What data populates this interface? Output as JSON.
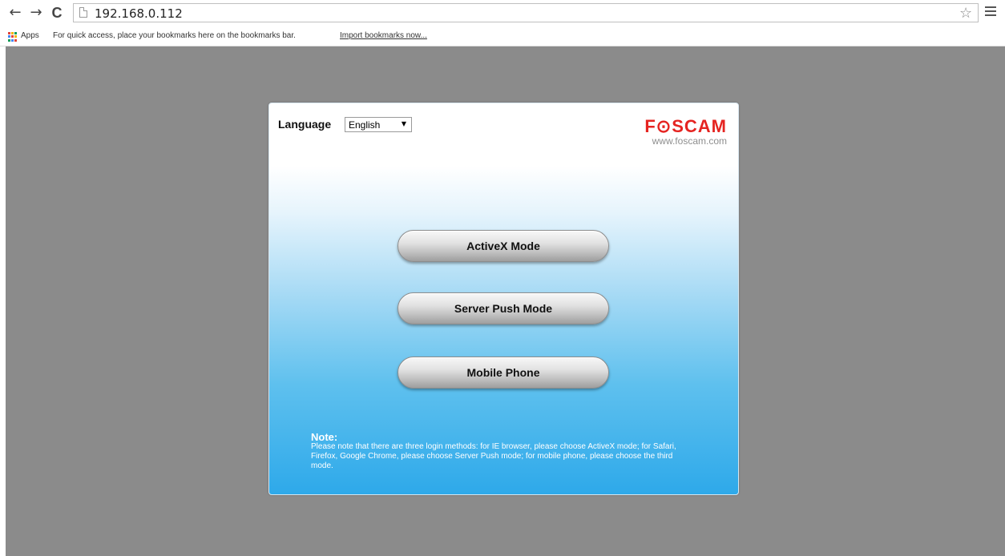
{
  "browser": {
    "back_glyph": "←",
    "forward_glyph": "→",
    "reload_glyph": "C",
    "url": "192.168.0.112",
    "star_glyph": "☆",
    "bookmarks_bar": {
      "apps_label": "Apps",
      "hint": "For quick access, place your bookmarks here on the bookmarks bar.",
      "import_link": "Import bookmarks now..."
    },
    "icons": [
      "back-icon",
      "forward-icon",
      "reload-icon",
      "page-icon",
      "star-icon",
      "menu-icon",
      "apps-icon"
    ]
  },
  "login_panel": {
    "language_label": "Language",
    "language_selected": "English",
    "language_arrow": "▼",
    "logo_text": "F⊙SCAM",
    "website": "www.foscam.com",
    "buttons": {
      "activex": "ActiveX Mode",
      "server_push": "Server Push Mode",
      "mobile": "Mobile Phone"
    },
    "note_title": "Note:",
    "note_text": "Please note that there are three login methods: for IE browser, please choose ActiveX mode; for Safari, Firefox, Google Chrome, please choose Server Push mode; for mobile phone, please choose the third mode."
  },
  "colors": {
    "brand_red": "#e52421",
    "page_background": "#8b8b8b",
    "panel_gradient_bottom": "#2ea9ea"
  }
}
